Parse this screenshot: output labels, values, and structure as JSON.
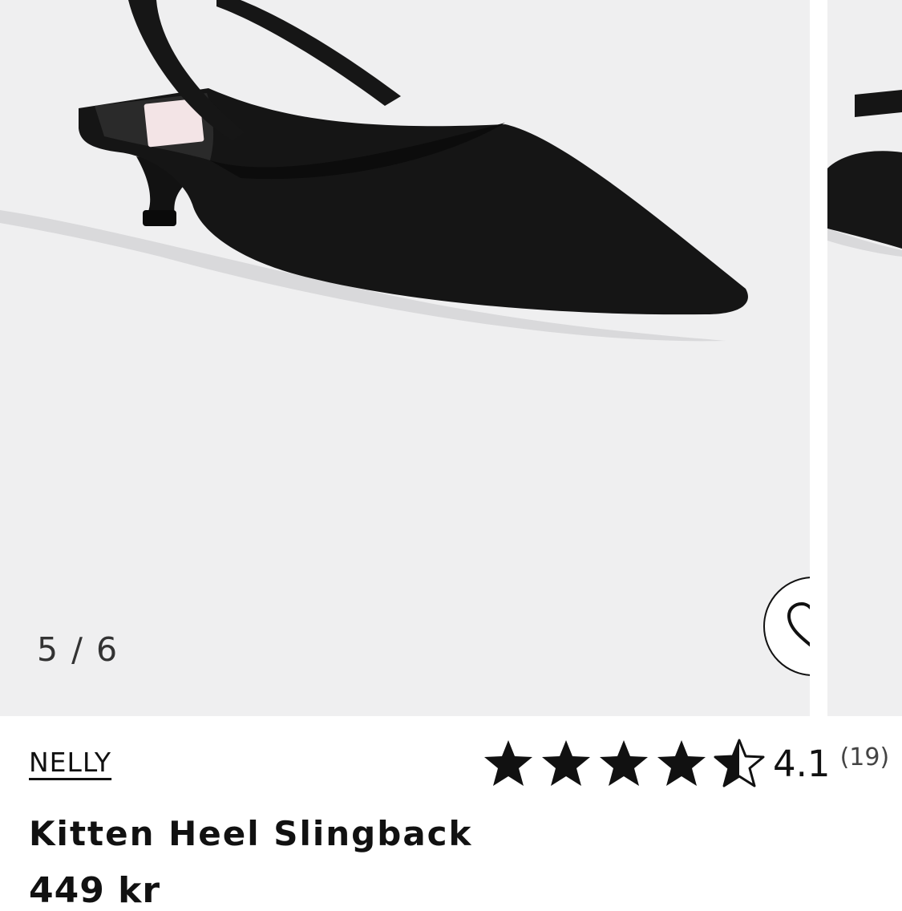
{
  "gallery": {
    "counter": "5 / 6",
    "favorite_icon": "heart-outline-icon"
  },
  "product": {
    "brand": "NELLY",
    "name": "Kitten Heel Slingback",
    "price": "449 kr",
    "rating": {
      "value": 4.1,
      "value_label": "4.1",
      "count_label": "(19)",
      "max_stars": 5
    }
  },
  "colors": {
    "image_background": "#efeff0",
    "text": "#111111",
    "page_background": "#ffffff"
  }
}
